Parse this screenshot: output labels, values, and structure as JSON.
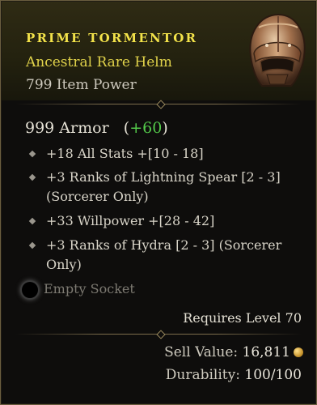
{
  "item": {
    "name": "PRIME TORMENTOR",
    "type": "Ancestral Rare Helm",
    "item_power": "799 Item Power",
    "armor_value": "999 Armor",
    "armor_bonus": "+60",
    "affixes": [
      "+18 All Stats +[10 - 18]",
      "+3 Ranks of Lightning Spear [2 - 3] (Sorcerer Only)",
      "+33 Willpower +[28 - 42]",
      "+3 Ranks of Hydra [2 - 3] (Sorcerer Only)"
    ],
    "socket": "Empty Socket",
    "requirement": "Requires Level 70",
    "sell_label": "Sell Value:",
    "sell_value": "16,811",
    "durability_label": "Durability:",
    "durability_value": "100/100"
  },
  "colors": {
    "title": "#f3e34a",
    "rarity": "#e0d24a",
    "bonus": "#53c94a",
    "border": "#6b5e3f"
  },
  "icons": {
    "item": "helm-icon",
    "bullet": "diamond-bullet-icon",
    "socket": "socket-ring-icon",
    "currency": "gold-coin-icon"
  }
}
